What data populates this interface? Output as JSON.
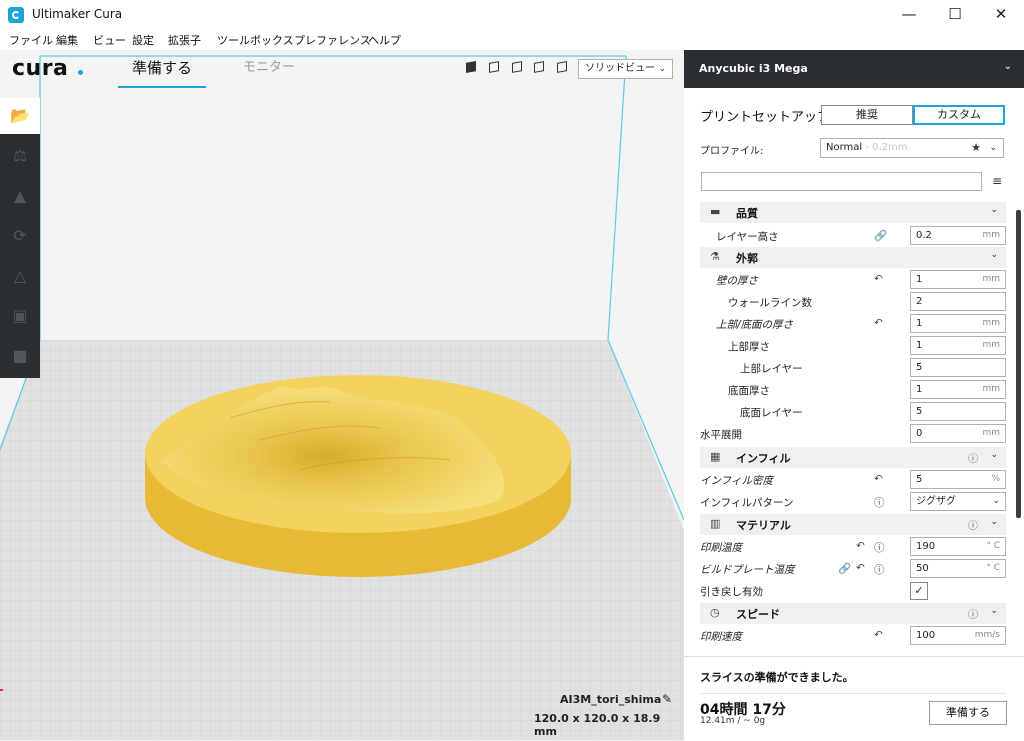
{
  "window": {
    "title": "Ultimaker Cura",
    "minimize_glyph": "—",
    "maximize_glyph": "☐",
    "close_glyph": "✕"
  },
  "menu": [
    "ファイル",
    "編集",
    "ビュー",
    "設定",
    "拡張子",
    "ツールボックス",
    "プレファレンス",
    "ヘルプ"
  ],
  "header": {
    "logo": "cura",
    "tabs": [
      {
        "label": "準備する",
        "active": true
      },
      {
        "label": "モニター",
        "active": false
      }
    ],
    "view_icons": [
      "view-3d-icon",
      "view-front-icon",
      "view-top-icon",
      "view-left-icon",
      "view-right-icon"
    ],
    "view_mode": "ソリッドビュー"
  },
  "toolbar": {
    "icons": [
      "open-file-icon",
      "move-tool-icon",
      "scale-tool-icon",
      "rotate-tool-icon",
      "mirror-tool-icon",
      "per-model-settings-icon",
      "support-blocker-icon"
    ]
  },
  "model": {
    "name": "AI3M_tori_shima",
    "dimensions": "120.0 x 120.0 x 18.9 mm",
    "color": "#f3d25d"
  },
  "printer": {
    "name": "Anycubic i3 Mega"
  },
  "setup": {
    "label": "プリントセットアップ",
    "recommended": "推奨",
    "custom": "カスタム",
    "profile_label": "プロファイル:",
    "profile_value": "Normal",
    "profile_sub": " - 0.2mm"
  },
  "settings": {
    "quality": {
      "label": "品質",
      "layer_height": {
        "label": "レイヤー高さ",
        "value": "0.2",
        "unit": "mm"
      }
    },
    "shell": {
      "label": "外郭",
      "wall_thickness": {
        "label": "壁の厚さ",
        "value": "1",
        "unit": "mm"
      },
      "wall_line_count": {
        "label": "ウォールライン数",
        "value": "2"
      },
      "top_bottom_thickness": {
        "label": "上部/底面の厚さ",
        "value": "1",
        "unit": "mm"
      },
      "top_thickness": {
        "label": "上部厚さ",
        "value": "1",
        "unit": "mm"
      },
      "top_layers": {
        "label": "上部レイヤー",
        "value": "5"
      },
      "bottom_thickness": {
        "label": "底面厚さ",
        "value": "1",
        "unit": "mm"
      },
      "bottom_layers": {
        "label": "底面レイヤー",
        "value": "5"
      },
      "horizontal_expansion": {
        "label": "水平展開",
        "value": "0",
        "unit": "mm"
      }
    },
    "infill": {
      "label": "インフィル",
      "density": {
        "label": "インフィル密度",
        "value": "5",
        "unit": "%"
      },
      "pattern": {
        "label": "インフィルパターン",
        "value": "ジグザグ"
      }
    },
    "material": {
      "label": "マテリアル",
      "print_temp": {
        "label": "印刷温度",
        "value": "190",
        "unit": "° C"
      },
      "bed_temp": {
        "label": "ビルドプレート温度",
        "value": "50",
        "unit": "° C"
      },
      "retraction": {
        "label": "引き戻し有効",
        "checked": true,
        "check_glyph": "✓"
      }
    },
    "speed": {
      "label": "スピード",
      "print_speed": {
        "label": "印刷速度",
        "value": "100",
        "unit": "mm/s"
      }
    }
  },
  "slice": {
    "status": "スライスの準備ができました。",
    "time": "04時間 17分",
    "material": "12.41m / ~ 0g",
    "button": "準備する"
  },
  "colors": {
    "accent": "#1aa4d7",
    "dark": "#2a2d31",
    "model": "#f3d25d"
  }
}
